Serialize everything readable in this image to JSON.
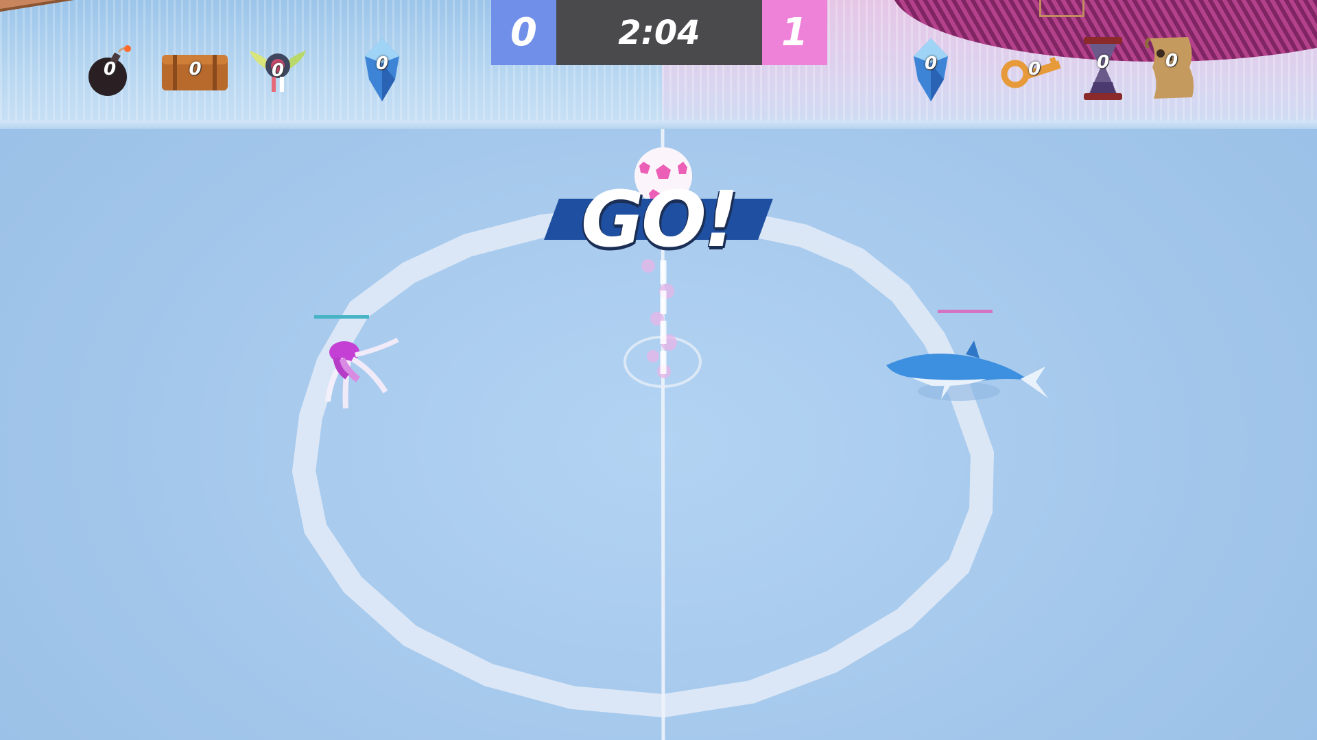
{
  "scoreboard": {
    "team_blue_score": "0",
    "timer": "2:04",
    "team_pink_score": "1",
    "team_blue_color": "#6f8fe9",
    "team_pink_color": "#ee82d8"
  },
  "banner": {
    "text": "GO!"
  },
  "powerups_left": [
    {
      "icon": "bomb-icon",
      "count": "0"
    },
    {
      "icon": "treasure-chest-icon",
      "count": "0"
    },
    {
      "icon": "winged-badge-icon",
      "count": "0"
    },
    {
      "icon": "ice-crystal-icon",
      "count": "0"
    }
  ],
  "powerups_right": [
    {
      "icon": "ice-crystal-icon",
      "count": "0"
    },
    {
      "icon": "key-icon",
      "count": "0"
    },
    {
      "icon": "hourglass-icon",
      "count": "0"
    },
    {
      "icon": "treasure-map-icon",
      "count": "0"
    }
  ],
  "players": [
    {
      "name": "octopus",
      "team": "blue",
      "color": "#c43fd4"
    },
    {
      "name": "dolphin",
      "team": "pink",
      "color": "#3d8fe0"
    }
  ],
  "ball": {
    "color": "#ec5fb6"
  }
}
